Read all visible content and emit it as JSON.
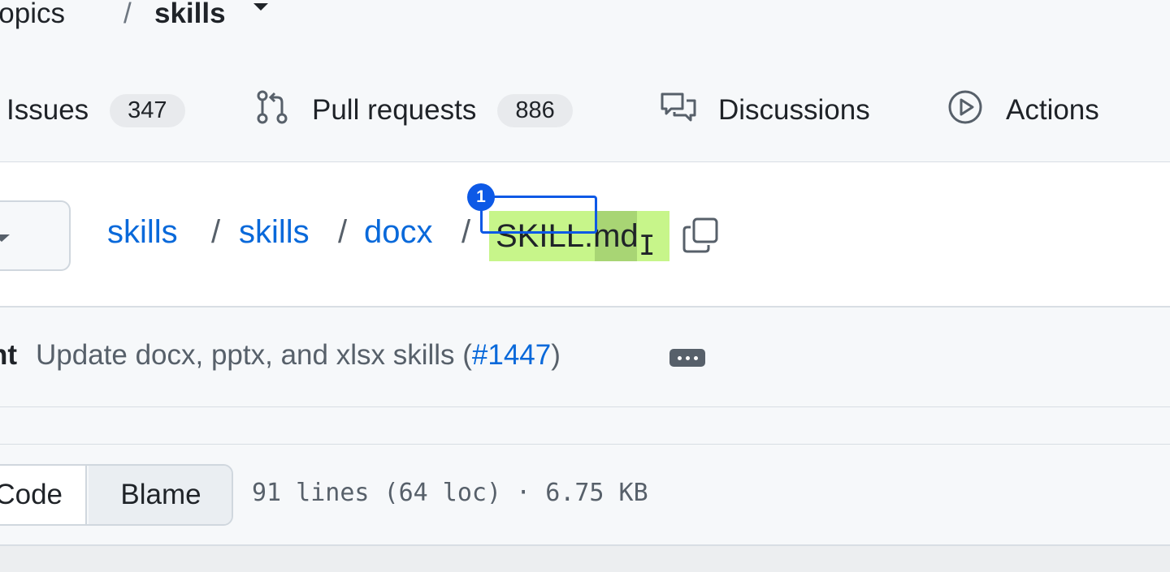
{
  "repo_path": {
    "owner": "nthropics",
    "separator": "/",
    "repo": "skills"
  },
  "nav": {
    "issues": {
      "label": "Issues",
      "count": "347"
    },
    "pull_requests": {
      "label": "Pull requests",
      "count": "886"
    },
    "discussions": {
      "label": "Discussions"
    },
    "actions": {
      "label": "Actions"
    }
  },
  "breadcrumb": {
    "items": [
      "skills",
      "skills",
      "docx"
    ],
    "separator": "/",
    "current": "SKILL.md",
    "cursor": "I"
  },
  "annotation": {
    "marker": "1"
  },
  "commit": {
    "author_fragment": "nt",
    "message_prefix": "Update docx, pptx, and xlsx skills (",
    "pr_link": "#1447",
    "message_suffix": ")"
  },
  "file_view": {
    "code_label": "Code",
    "blame_label": "Blame",
    "meta": "91 lines (64 loc) · 6.75 KB"
  },
  "colors": {
    "link": "#0969da",
    "selection_highlight": "#c7f58a",
    "annotation_blue": "#0d59e6"
  }
}
